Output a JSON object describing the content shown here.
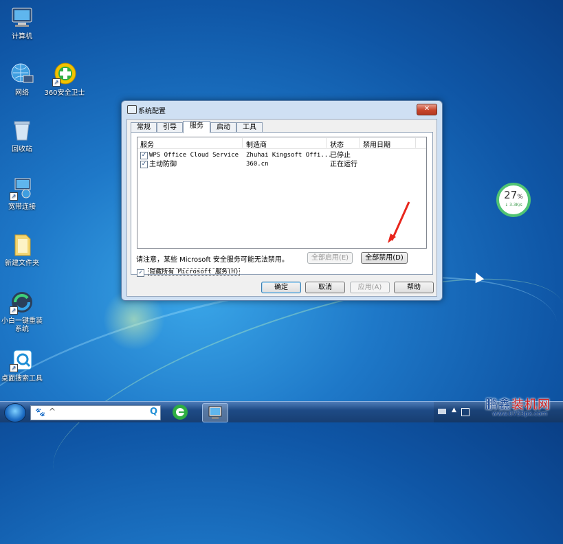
{
  "desktop": {
    "icons": [
      {
        "label": "计算机"
      },
      {
        "label": "网络"
      },
      {
        "label": "360安全卫士"
      },
      {
        "label": "回收站"
      },
      {
        "label": "宽带连接"
      },
      {
        "label": "新建文件夹"
      },
      {
        "label": "小白一键重装系统"
      },
      {
        "label": "桌面搜索工具"
      }
    ]
  },
  "window": {
    "title": "系统配置",
    "close_label": "✕",
    "tabs": [
      {
        "label": "常规"
      },
      {
        "label": "引导"
      },
      {
        "label": "服务",
        "active": true
      },
      {
        "label": "启动"
      },
      {
        "label": "工具"
      }
    ],
    "columns": [
      "服务",
      "制造商",
      "状态",
      "禁用日期"
    ],
    "rows": [
      {
        "checked": true,
        "service": "WPS Office Cloud Service",
        "maker": "Zhuhai Kingsoft Offi...",
        "status": "已停止",
        "date": ""
      },
      {
        "checked": true,
        "service": "主动防御",
        "maker": "360.cn",
        "status": "正在运行",
        "date": ""
      }
    ],
    "note": "请注意，某些 Microsoft 安全服务可能无法禁用。",
    "enable_all_label": "全部启用(E)",
    "disable_all_label": "全部禁用(D)",
    "hide_ms_label": "隐藏所有 Microsoft 服务(H)",
    "hide_ms_checked": true,
    "ok_label": "确定",
    "cancel_label": "取消",
    "apply_label": "应用(A)",
    "help_label": "帮助"
  },
  "net_widget": {
    "percent": "27",
    "unit": "%",
    "speed": "↓ 3.3K/s"
  },
  "watermark": {
    "brand_a": "鹏鑫",
    "brand_b": "装机网",
    "url": "www.0753px.com"
  },
  "colors": {
    "accent_green": "#51c473",
    "arrow_red": "#e8261c",
    "window_frame": "#cfe0f3"
  }
}
